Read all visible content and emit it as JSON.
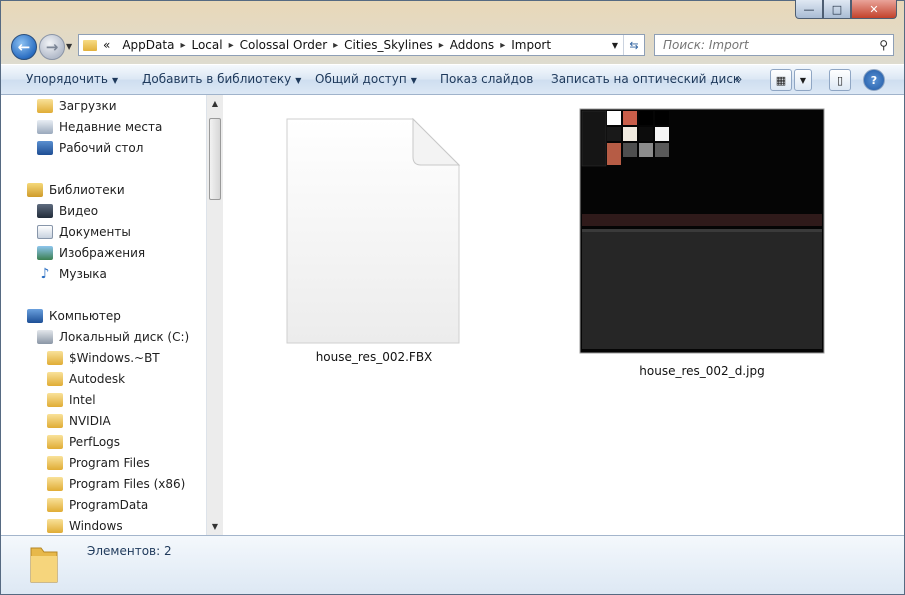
{
  "window": {
    "controls": {
      "minimize": "—",
      "maximize": "□",
      "close": "✕"
    }
  },
  "address": {
    "crumbs": [
      "AppData",
      "Local",
      "Colossal Order",
      "Cities_Skylines",
      "Addons",
      "Import"
    ],
    "overflow": "«"
  },
  "search": {
    "placeholder": "Поиск: Import"
  },
  "toolbar": {
    "organize": "Упорядочить",
    "add_to_library": "Добавить в библиотеку",
    "share": "Общий доступ",
    "slideshow": "Показ слайдов",
    "burn": "Записать на оптический диск",
    "more": "»"
  },
  "nav": {
    "favorites": [
      "Загрузки",
      "Недавние места",
      "Рабочий стол"
    ],
    "libraries_label": "Библиотеки",
    "libraries": [
      "Видео",
      "Документы",
      "Изображения",
      "Музыка"
    ],
    "computer_label": "Компьютер",
    "disk_label": "Локальный диск (C:)",
    "disk_folders": [
      "$Windows.~BT",
      "Autodesk",
      "Intel",
      "NVIDIA",
      "PerfLogs",
      "Program Files",
      "Program Files (x86)",
      "ProgramData",
      "Windows"
    ]
  },
  "files": [
    {
      "name": "house_res_002.FBX",
      "type": "generic-file"
    },
    {
      "name": "house_res_002_d.jpg",
      "type": "image-thumbnail"
    }
  ],
  "status": {
    "count_text": "Элементов: 2"
  },
  "colors": {
    "accent": "#1e395b",
    "window_frame": "#b9d3ea"
  }
}
